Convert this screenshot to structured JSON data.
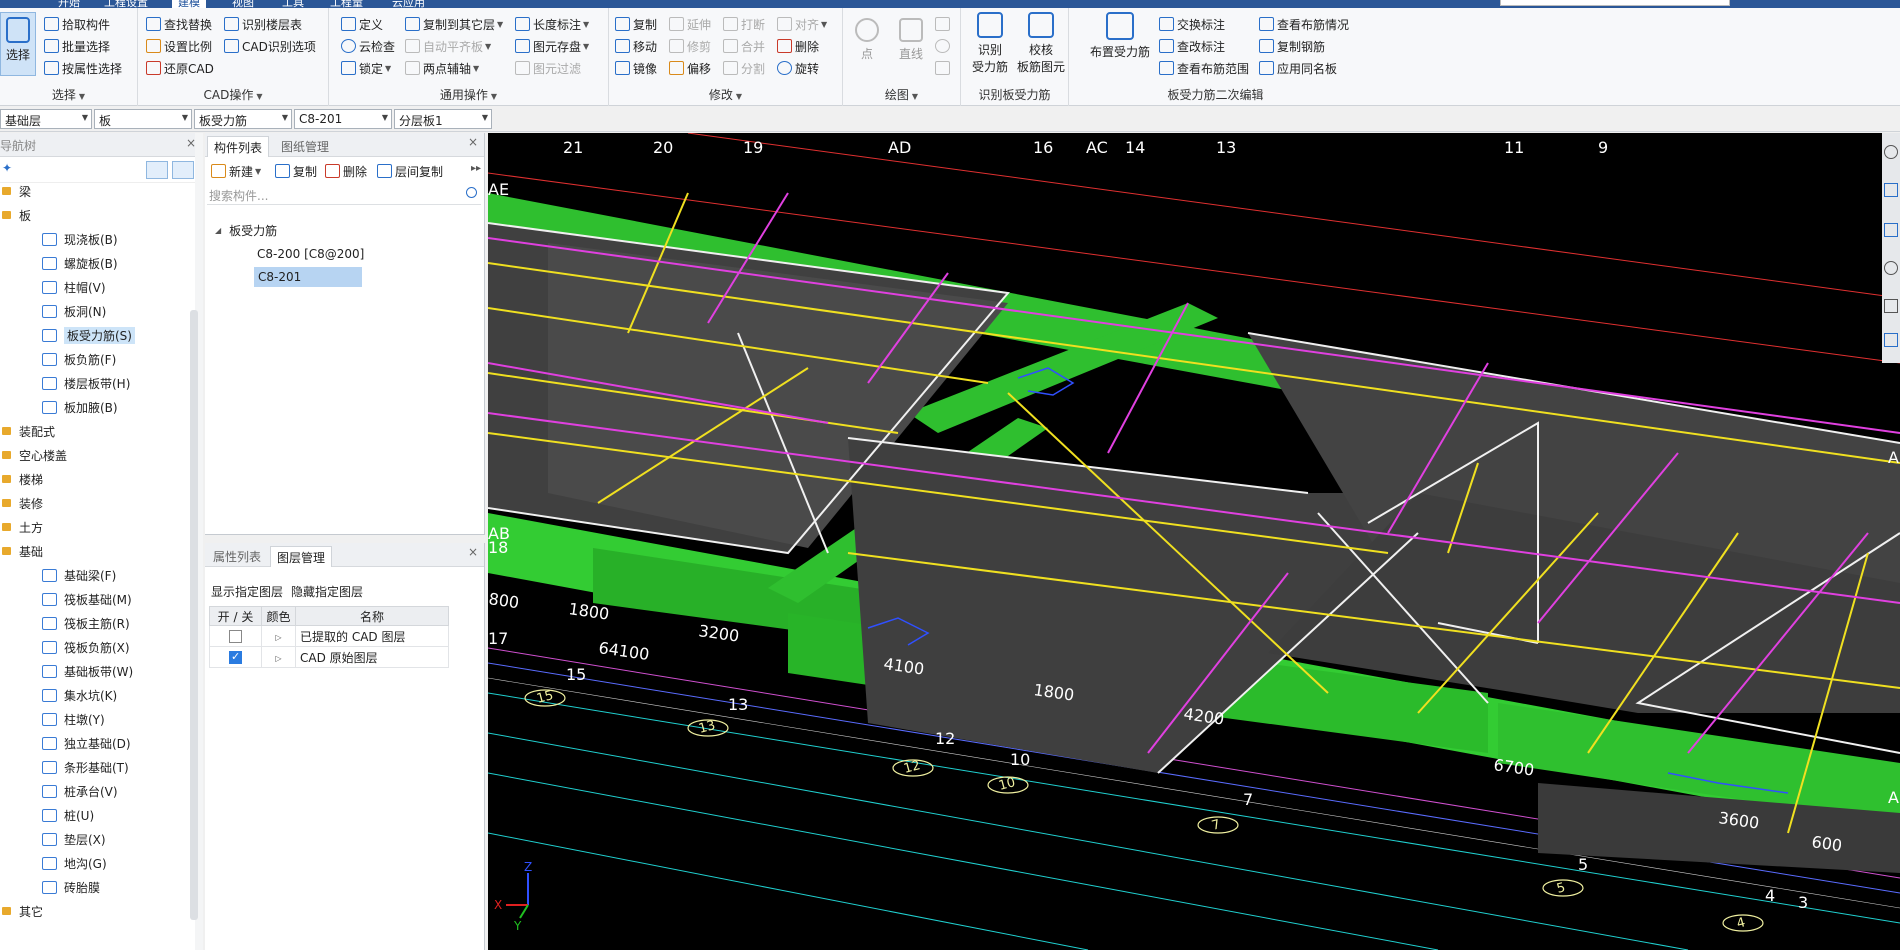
{
  "top_tabs": [
    "开始",
    "工程设置",
    "建模",
    "视图",
    "工具",
    "工程量",
    "云应用"
  ],
  "ribbon": {
    "select_group": {
      "big": "选择",
      "items": [
        "拾取构件",
        "批量选择",
        "按属性选择"
      ],
      "label": "选择"
    },
    "cad_group": {
      "items": [
        "查找替换",
        "识别楼层表",
        "设置比例",
        "CAD识别选项",
        "还原CAD"
      ],
      "label": "CAD操作"
    },
    "common_group": {
      "items": [
        "定义",
        "复制到其它层",
        "长度标注",
        "云检查",
        "自动平齐板",
        "图元存盘",
        "锁定",
        "两点辅轴",
        "图元过滤"
      ],
      "label": "通用操作"
    },
    "modify_group": {
      "items": [
        "复制",
        "延伸",
        "打断",
        "对齐",
        "移动",
        "修剪",
        "合并",
        "删除",
        "镜像",
        "偏移",
        "分割",
        "旋转"
      ],
      "label": "修改"
    },
    "draw_group": {
      "items": [
        "点",
        "直线"
      ],
      "label": "绘图"
    },
    "identify_group": {
      "items": [
        "识别\n受力筋",
        "校核\n板筋图元"
      ],
      "item1a": "识别",
      "item1b": "受力筋",
      "item2a": "校核",
      "item2b": "板筋图元",
      "label": "识别板受力筋"
    },
    "edit_group": {
      "big": "布置受力筋",
      "items": [
        "交换标注",
        "查看布筋情况",
        "查改标注",
        "复制钢筋",
        "查看布筋范围",
        "应用同名板"
      ],
      "label": "板受力筋二次编辑"
    }
  },
  "selectors": [
    "基础层",
    "板",
    "板受力筋",
    "C8-201",
    "分层板1"
  ],
  "nav": {
    "title": "导航树",
    "items": [
      {
        "label": "梁",
        "type": "folder"
      },
      {
        "label": "板",
        "type": "folder"
      },
      {
        "label": "现浇板(B)",
        "type": "child"
      },
      {
        "label": "螺旋板(B)",
        "type": "child"
      },
      {
        "label": "柱帽(V)",
        "type": "child"
      },
      {
        "label": "板洞(N)",
        "type": "child"
      },
      {
        "label": "板受力筋(S)",
        "type": "child",
        "selected": true
      },
      {
        "label": "板负筋(F)",
        "type": "child"
      },
      {
        "label": "楼层板带(H)",
        "type": "child"
      },
      {
        "label": "板加腋(B)",
        "type": "child"
      },
      {
        "label": "装配式",
        "type": "folder"
      },
      {
        "label": "空心楼盖",
        "type": "folder"
      },
      {
        "label": "楼梯",
        "type": "folder"
      },
      {
        "label": "装修",
        "type": "folder"
      },
      {
        "label": "土方",
        "type": "folder"
      },
      {
        "label": "基础",
        "type": "folder"
      },
      {
        "label": "基础梁(F)",
        "type": "child"
      },
      {
        "label": "筏板基础(M)",
        "type": "child"
      },
      {
        "label": "筏板主筋(R)",
        "type": "child"
      },
      {
        "label": "筏板负筋(X)",
        "type": "child"
      },
      {
        "label": "基础板带(W)",
        "type": "child"
      },
      {
        "label": "集水坑(K)",
        "type": "child"
      },
      {
        "label": "柱墩(Y)",
        "type": "child"
      },
      {
        "label": "独立基础(D)",
        "type": "child"
      },
      {
        "label": "条形基础(T)",
        "type": "child"
      },
      {
        "label": "桩承台(V)",
        "type": "child"
      },
      {
        "label": "桩(U)",
        "type": "child"
      },
      {
        "label": "垫层(X)",
        "type": "child"
      },
      {
        "label": "地沟(G)",
        "type": "child"
      },
      {
        "label": "砖胎膜",
        "type": "child"
      },
      {
        "label": "其它",
        "type": "folder"
      }
    ]
  },
  "components": {
    "tabs": [
      "构件列表",
      "图纸管理"
    ],
    "toolbar": [
      "新建",
      "复制",
      "删除",
      "层间复制"
    ],
    "search_placeholder": "搜索构件...",
    "root": "板受力筋",
    "children": [
      "C8-200 [C8@200]",
      "C8-201"
    ]
  },
  "layers": {
    "tabs": [
      "属性列表",
      "图层管理"
    ],
    "actions": [
      "显示指定图层",
      "隐藏指定图层"
    ],
    "headers": [
      "开 / 关",
      "颜色",
      "名称"
    ],
    "rows": [
      {
        "on": false,
        "name": "已提取的 CAD 图层"
      },
      {
        "on": true,
        "name": "CAD 原始图层"
      }
    ]
  },
  "viewport": {
    "top_axes": [
      "21",
      "20",
      "19",
      "AD",
      "16",
      "AC",
      "14",
      "13",
      "11",
      "9"
    ],
    "left_labels": [
      "AE",
      "AB",
      "18",
      "17"
    ],
    "dims": [
      "800",
      "1800",
      "3200",
      "64100",
      "4100",
      "1800",
      "4200",
      "6700",
      "3600",
      "600"
    ],
    "circle_axes": [
      "15",
      "13",
      "12",
      "10",
      "7",
      "5",
      "4",
      "3"
    ],
    "axis_numbers": [
      "15",
      "13",
      "12",
      "10",
      "7",
      "5",
      "4",
      "3"
    ],
    "right_labels": [
      "A",
      "A"
    ],
    "gizmo": [
      "Z",
      "X",
      "Y"
    ]
  }
}
